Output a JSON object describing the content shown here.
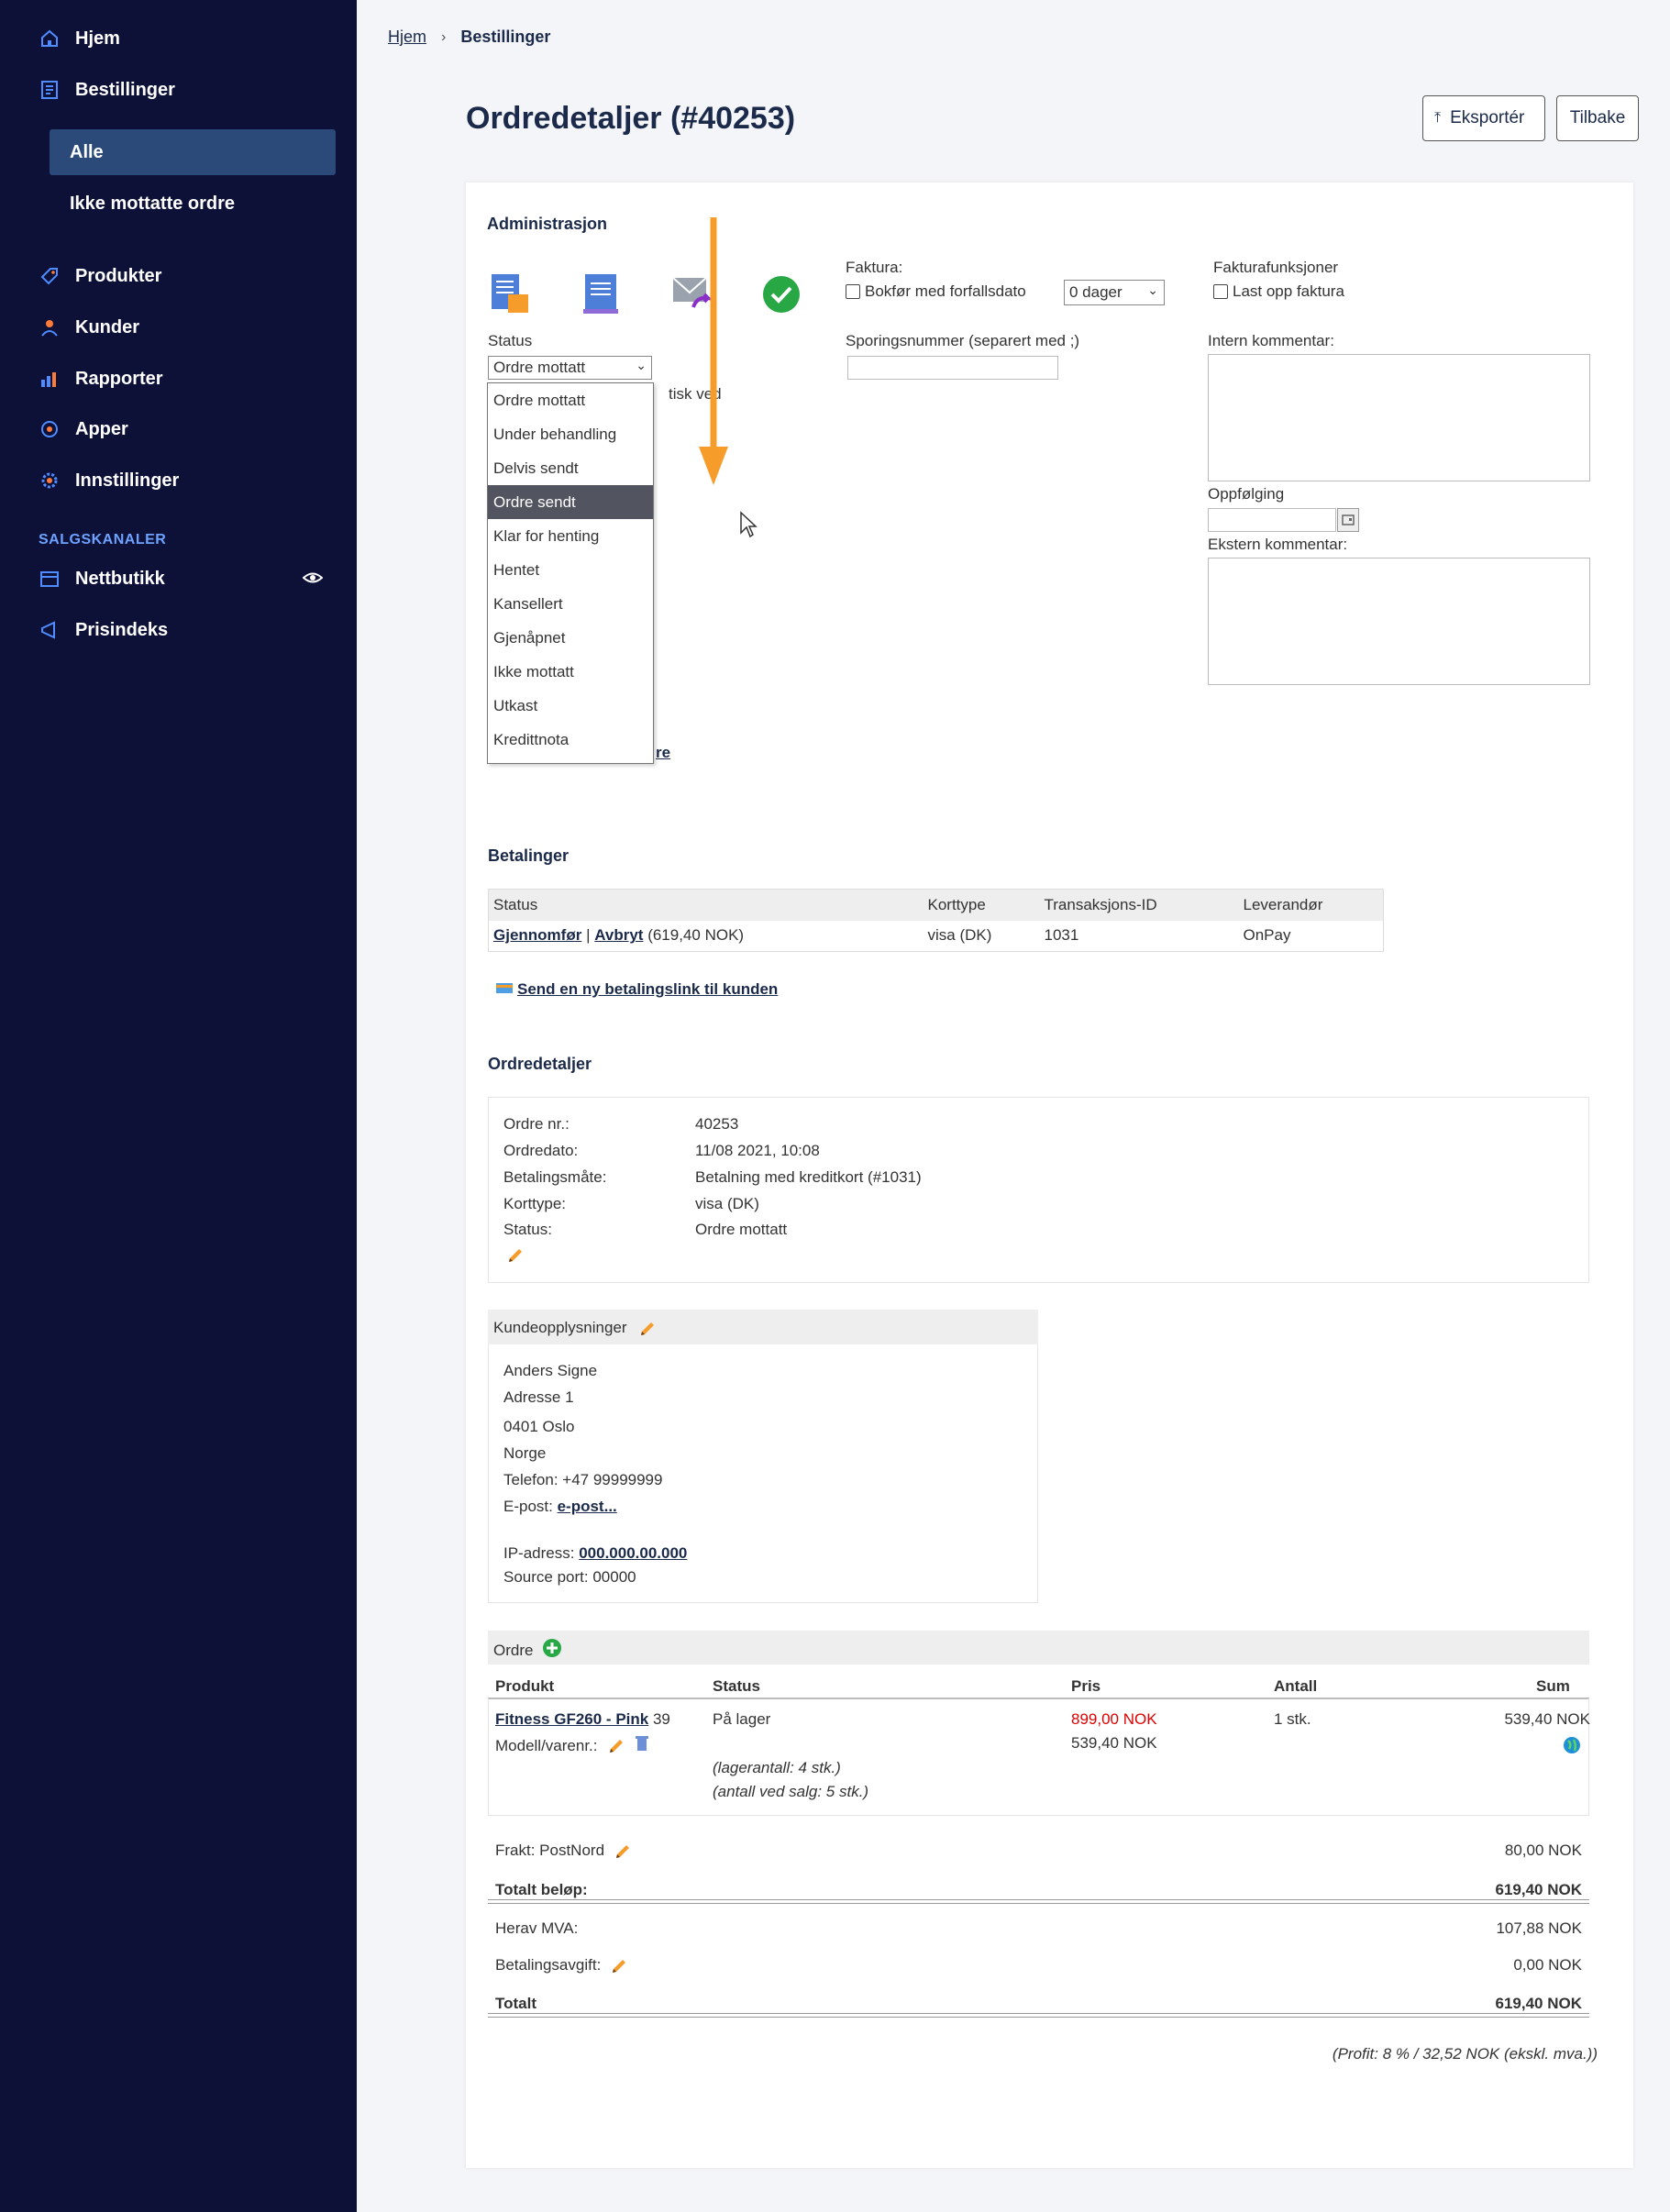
{
  "sidebar": {
    "items": [
      {
        "label": "Hjem",
        "icon": "home-icon"
      },
      {
        "label": "Bestillinger",
        "icon": "orders-icon"
      },
      {
        "label": "Produkter",
        "icon": "tag-icon"
      },
      {
        "label": "Kunder",
        "icon": "user-icon"
      },
      {
        "label": "Rapporter",
        "icon": "chart-icon"
      },
      {
        "label": "Apper",
        "icon": "apps-icon"
      },
      {
        "label": "Innstillinger",
        "icon": "gear-icon"
      }
    ],
    "sub_items": [
      {
        "label": "Alle",
        "active": true
      },
      {
        "label": "Ikke mottatte ordre",
        "active": false
      }
    ],
    "section_title": "SALGSKANALER",
    "channels": [
      {
        "label": "Nettbutikk",
        "icon": "store-icon"
      },
      {
        "label": "Prisindeks",
        "icon": "megaphone-icon"
      }
    ]
  },
  "breadcrumb": {
    "home": "Hjem",
    "current": "Bestillinger"
  },
  "page": {
    "title": "Ordredetaljer (#40253)",
    "export_label": "Eksportér",
    "back_label": "Tilbake"
  },
  "admin": {
    "heading": "Administrasjon",
    "status_label": "Status",
    "status_value": "Ordre mottatt",
    "hidden_text": "tisk ved",
    "partial_link": "re",
    "faktura_label": "Faktura:",
    "bokfor_label": "Bokfør med forfallsdato",
    "days_value": "0 dager",
    "fakturafunksjoner_label": "Fakturafunksjoner",
    "last_opp_label": "Last opp faktura",
    "sporing_label": "Sporingsnummer (separert med ;)",
    "intern_label": "Intern kommentar:",
    "oppfolging_label": "Oppfølging",
    "ekstern_label": "Ekstern kommentar:",
    "status_options": [
      "Ordre mottatt",
      "Under behandling",
      "Delvis sendt",
      "Ordre sendt",
      "Klar for henting",
      "Hentet",
      "Kansellert",
      "Gjenåpnet",
      "Ikke mottatt",
      "Utkast",
      "Kredittnota"
    ],
    "highlighted_option": "Ordre sendt"
  },
  "payments": {
    "heading": "Betalinger",
    "columns": [
      "Status",
      "Korttype",
      "Transaksjons-ID",
      "Leverandør"
    ],
    "row": {
      "complete": "Gjennomfør",
      "sep": "|",
      "cancel": "Avbryt",
      "amount": "(619,40 NOK)",
      "card": "visa (DK)",
      "tx_id": "1031",
      "provider": "OnPay"
    },
    "send_link": "Send en ny betalingslink til kunden"
  },
  "order_details": {
    "heading": "Ordredetaljer",
    "rows": [
      {
        "label": "Ordre nr.:",
        "value": "40253"
      },
      {
        "label": "Ordredato:",
        "value": "11/08 2021, 10:08"
      },
      {
        "label": "Betalingsmåte:",
        "value": "Betalning med kreditkort (#1031)"
      },
      {
        "label": "Korttype:",
        "value": "visa (DK)"
      },
      {
        "label": "Status:",
        "value": "Ordre mottatt"
      }
    ]
  },
  "customer": {
    "heading": "Kundeopplysninger",
    "name": "Anders Signe",
    "address": "Adresse 1",
    "city": "0401 Oslo",
    "country": "Norge",
    "phone": "Telefon: +47 99999999",
    "email_label": "E-post:",
    "email_link": "e-post...",
    "ip_label": "IP-adress:",
    "ip_value": "000.000.00.000",
    "source_port": "Source port: 00000"
  },
  "order": {
    "heading": "Ordre",
    "columns": {
      "product": "Produkt",
      "status": "Status",
      "price": "Pris",
      "qty": "Antall",
      "sum": "Sum"
    },
    "item": {
      "name": "Fitness GF260 - Pink",
      "num": "39",
      "model_label": "Modell/varenr.:",
      "status": "På lager",
      "stock": "(lagerantall: 4 stk.)",
      "at_sale": "(antall ved salg: 5 stk.)",
      "price_orig": "899,00 NOK",
      "price": "539,40 NOK",
      "qty": "1 stk.",
      "sum": "539,40 NOK"
    },
    "shipping_label": "Frakt: PostNord",
    "shipping_value": "80,00 NOK",
    "total_amount_label": "Totalt beløp:",
    "total_amount_value": "619,40 NOK",
    "vat_label": "Herav MVA:",
    "vat_value": "107,88 NOK",
    "fee_label": "Betalingsavgift:",
    "fee_value": "0,00 NOK",
    "total_label": "Totalt",
    "total_value": "619,40 NOK",
    "profit": "(Profit: 8 % / 32,52 NOK (ekskl. mva.))"
  },
  "colors": {
    "sidebar_bg": "#0d1037",
    "active_bg": "#2b4a7a",
    "accent_arrow": "#f59c2a",
    "price_red": "#e00000",
    "section_blue": "#6da2ff"
  }
}
